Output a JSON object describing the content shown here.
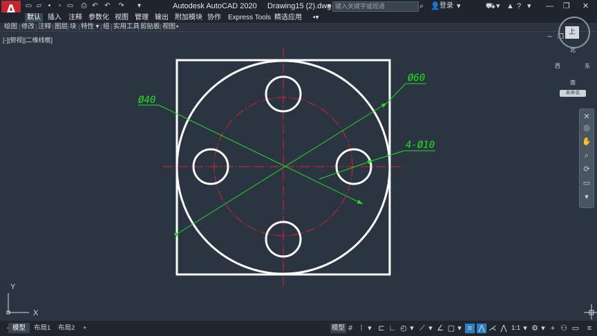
{
  "app": {
    "logo_letter": "A",
    "title": "Autodesk AutoCAD 2020",
    "document": "Drawing15 (2).dwg",
    "search_placeholder": "键入关键字或短语",
    "login": "登录"
  },
  "ribbon_tabs": [
    "默认",
    "插入",
    "注释",
    "参数化",
    "视图",
    "管理",
    "输出",
    "附加模块",
    "协作",
    "Express Tools",
    "精选应用"
  ],
  "panel_bar": [
    "绘图",
    "修改",
    "注释",
    "图层",
    "块",
    "特性",
    "组",
    "实用工具",
    "剪贴板",
    "视图"
  ],
  "viewport_label": "[-][俯视][二维线框]",
  "viewcube": {
    "top": "上",
    "north": "北",
    "south": "南",
    "east": "东",
    "west": "西",
    "wcs": "未命名"
  },
  "drawing": {
    "dim_60": "Ø60",
    "dim_40": "Ø40",
    "dim_holes": "4-Ø10",
    "colors": {
      "geometry": "#ffffff",
      "centerline": "#e0212a",
      "dimension": "#1fe01f",
      "background": "#2b3542"
    }
  },
  "ucs": {
    "x": "X",
    "y": "Y"
  },
  "layout_tabs": [
    "模型",
    "布局1",
    "布局2"
  ],
  "add_tab": "+",
  "status": {
    "model": "模型",
    "scale": "1:1"
  }
}
